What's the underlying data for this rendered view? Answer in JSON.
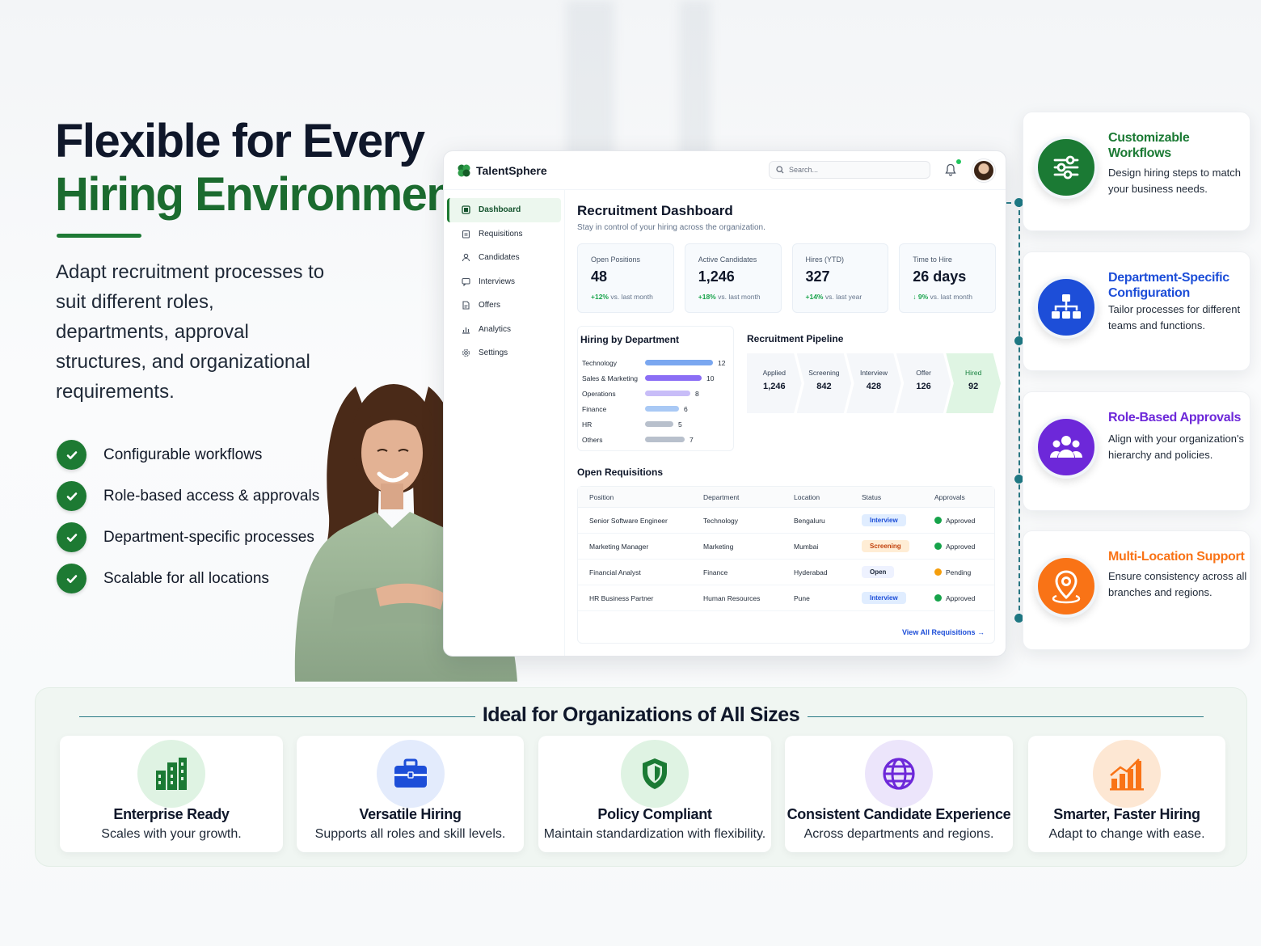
{
  "hero": {
    "title_line1": "Flexible for Every",
    "title_line2": "Hiring Environment",
    "description": "Adapt recruitment processes to suit different roles, departments, approval structures, and organizational requirements.",
    "checks": [
      "Configurable workflows",
      "Role-based access & approvals",
      "Department-specific processes",
      "Scalable for all locations"
    ]
  },
  "app": {
    "brand": "TalentSphere",
    "search_placeholder": "Search...",
    "nav": [
      "Dashboard",
      "Requisitions",
      "Candidates",
      "Interviews",
      "Offers",
      "Analytics",
      "Settings"
    ],
    "title": "Recruitment Dashboard",
    "subtitle": "Stay in control of your hiring across the organization.",
    "kpis": [
      {
        "label": "Open Positions",
        "value": "48",
        "delta": "+12%",
        "note": "vs. last month"
      },
      {
        "label": "Active Candidates",
        "value": "1,246",
        "delta": "+18%",
        "note": "vs. last month"
      },
      {
        "label": "Hires (YTD)",
        "value": "327",
        "delta": "+14%",
        "note": "vs. last year"
      },
      {
        "label": "Time to Hire",
        "value": "26 days",
        "delta": "↓ 9%",
        "note": "vs. last month"
      }
    ],
    "dept_title": "Hiring by Department",
    "departments": [
      {
        "name": "Technology",
        "value": "12",
        "color": "#7aa7f0"
      },
      {
        "name": "Sales & Marketing",
        "value": "10",
        "color": "#8b6ef5"
      },
      {
        "name": "Operations",
        "value": "8",
        "color": "#c8bdf8"
      },
      {
        "name": "Finance",
        "value": "6",
        "color": "#a9c9f5"
      },
      {
        "name": "HR",
        "value": "5",
        "color": "#b8c0cc"
      },
      {
        "name": "Others",
        "value": "7",
        "color": "#b8c0cc"
      }
    ],
    "pipeline_title": "Recruitment Pipeline",
    "pipeline": [
      {
        "label": "Applied",
        "value": "1,246"
      },
      {
        "label": "Screening",
        "value": "842"
      },
      {
        "label": "Interview",
        "value": "428"
      },
      {
        "label": "Offer",
        "value": "126"
      },
      {
        "label": "Hired",
        "value": "92"
      }
    ],
    "req_title": "Open Requisitions",
    "req_headers": [
      "Position",
      "Department",
      "Location",
      "Status",
      "Approvals"
    ],
    "requisitions": [
      {
        "position": "Senior Software Engineer",
        "department": "Technology",
        "location": "Bengaluru",
        "status": "Interview",
        "approval": "Approved"
      },
      {
        "position": "Marketing Manager",
        "department": "Marketing",
        "location": "Mumbai",
        "status": "Screening",
        "approval": "Approved"
      },
      {
        "position": "Financial Analyst",
        "department": "Finance",
        "location": "Hyderabad",
        "status": "Open",
        "approval": "Pending"
      },
      {
        "position": "HR Business Partner",
        "department": "Human Resources",
        "location": "Pune",
        "status": "Interview",
        "approval": "Approved"
      }
    ],
    "view_all": "View All Requisitions →"
  },
  "features": [
    {
      "title": "Customizable Workflows",
      "desc": "Design hiring steps to match your business needs.",
      "color": "#1b7a34",
      "icon": "sliders-icon"
    },
    {
      "title": "Department-Specific Configuration",
      "desc": "Tailor processes for different teams and functions.",
      "color": "#1d4ed8",
      "icon": "org-chart-icon"
    },
    {
      "title": "Role-Based Approvals",
      "desc": "Align with your organization's hierarchy and policies.",
      "color": "#6d28d9",
      "icon": "people-icon"
    },
    {
      "title": "Multi-Location Support",
      "desc": "Ensure consistency across all branches and regions.",
      "color": "#f97316",
      "icon": "location-pin-icon"
    }
  ],
  "bottom": {
    "title": "Ideal for Organizations of All Sizes",
    "cards": [
      {
        "title": "Enterprise Ready",
        "desc": "Scales with your growth.",
        "icon": "buildings-icon"
      },
      {
        "title": "Versatile Hiring",
        "desc": "Supports all roles and skill levels.",
        "icon": "briefcase-icon"
      },
      {
        "title": "Policy Compliant",
        "desc": "Maintain standardization with flexibility.",
        "icon": "shield-check-icon"
      },
      {
        "title": "Consistent Candidate Experience",
        "desc": "Across departments and regions.",
        "icon": "globe-icon"
      },
      {
        "title": "Smarter, Faster Hiring",
        "desc": "Adapt to change with ease.",
        "icon": "bar-chart-icon"
      }
    ]
  }
}
